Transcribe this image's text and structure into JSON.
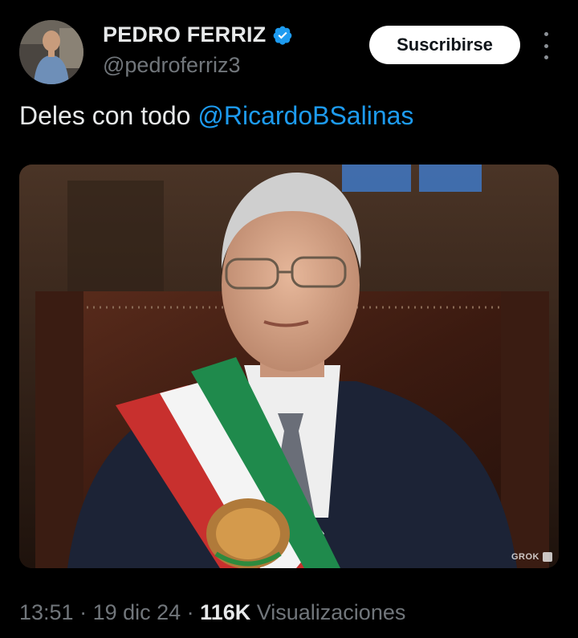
{
  "author": {
    "display_name": "PEDRO FERRIZ",
    "handle": "@pedroferriz3",
    "verified": true
  },
  "actions": {
    "subscribe_label": "Suscribirse"
  },
  "tweet": {
    "text": "Deles con todo ",
    "mention": "@RicardoBSalinas",
    "media_alt": "Portrait of a man in a dark suit wearing the Mexican presidential sash, seated in a leather chair",
    "watermark": "GROK"
  },
  "meta": {
    "time": "13:51",
    "sep1": " · ",
    "date": "19 dic 24",
    "sep2": " · ",
    "views_count": "116K",
    "views_label": " Visualizaciones"
  },
  "colors": {
    "background": "#000000",
    "mention": "#1d9bf0",
    "secondary_text": "#71767b",
    "verified_badge": "#1d9bf0"
  }
}
